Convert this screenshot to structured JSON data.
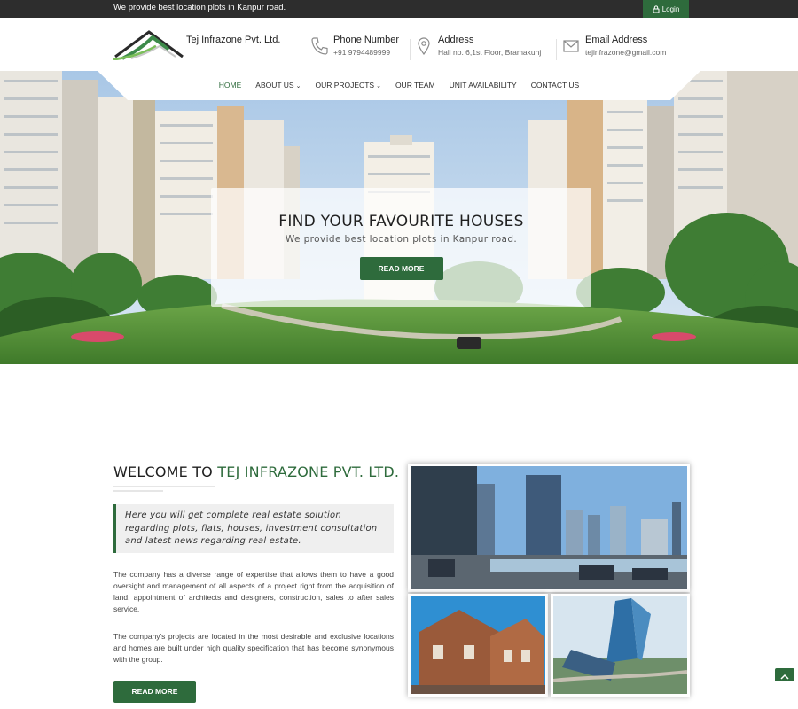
{
  "topbar": {
    "tagline": "We provide best location plots in Kanpur road.",
    "login_label": "Login",
    "login_icon": "lock-icon"
  },
  "brand": {
    "name": "Tej Infrazone Pvt. Ltd.",
    "logo_icon": "roof-logo-icon"
  },
  "contacts": {
    "phone": {
      "title": "Phone Number",
      "value": "+91 9794489999",
      "icon": "phone-icon"
    },
    "address": {
      "title": "Address",
      "value": "Hall no. 6,1st Floor, Bramakunj",
      "icon": "map-pin-icon"
    },
    "email": {
      "title": "Email Address",
      "value": "tejinfrazone@gmail.com",
      "icon": "envelope-icon"
    }
  },
  "nav": {
    "items": [
      {
        "label": "HOME",
        "active": true,
        "dropdown": false
      },
      {
        "label": "ABOUT US",
        "active": false,
        "dropdown": true
      },
      {
        "label": "OUR PROJECTS",
        "active": false,
        "dropdown": true
      },
      {
        "label": "OUR TEAM",
        "active": false,
        "dropdown": false
      },
      {
        "label": "UNIT AVAILABILITY",
        "active": false,
        "dropdown": false
      },
      {
        "label": "CONTACT US",
        "active": false,
        "dropdown": false
      }
    ],
    "chevron": "⌄"
  },
  "hero": {
    "title": "FIND YOUR FAVOURITE HOUSES",
    "subtitle": "We provide best location plots in Kanpur road.",
    "button_label": "READ MORE"
  },
  "welcome": {
    "title_prefix": "WELCOME TO",
    "title_highlight": "TEJ INFRAZONE PVT. LTD.",
    "quote": "Here you will get complete real estate solution regarding plots, flats, houses, investment consultation and latest news regarding real estate.",
    "paragraph1": "The company has a diverse range of expertise that allows them to have a good oversight and management of all aspects of a project right from the acquisition of land, appointment of architects and designers, construction, sales to after sales service.",
    "paragraph2": "The company's projects are located in the most desirable and exclusive locations and homes are built under high quality specification that has become synonymous with the group.",
    "button_label": "READ MORE"
  },
  "colors": {
    "brand_green": "#2e6b3c",
    "topbar": "#2d2d2d"
  },
  "icons": {
    "scroll_top": "chevron-up-icon"
  }
}
